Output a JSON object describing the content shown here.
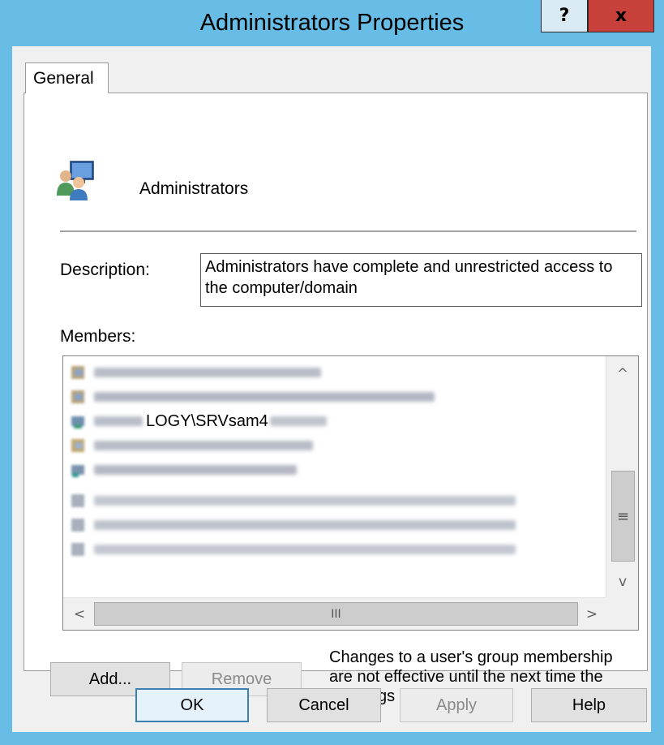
{
  "window": {
    "title": "Administrators Properties",
    "help_label": "?",
    "close_label": "x"
  },
  "tabs": [
    {
      "label": "General"
    }
  ],
  "group": {
    "name": "Administrators",
    "description_label": "Description:",
    "description": "Administrators have complete and unrestricted access to the computer/domain",
    "members_label": "Members:"
  },
  "members": [
    {
      "text": "",
      "blurred": true
    },
    {
      "text": "",
      "blurred": true
    },
    {
      "text": "LOGY\\SRVsam4",
      "blurred": false
    },
    {
      "text": "",
      "blurred": true
    },
    {
      "text": "",
      "blurred": true
    },
    {
      "text": "",
      "blurred": true
    },
    {
      "text": "",
      "blurred": true
    },
    {
      "text": "",
      "blurred": true
    }
  ],
  "scrollbars": {
    "up": "^",
    "down": "v",
    "left": "<",
    "right": ">",
    "v_grip": "≡",
    "h_grip": "III"
  },
  "member_buttons": {
    "add": "Add...",
    "remove": "Remove"
  },
  "note": "Changes to a user's group membership are not effective until the next time the user logs on.",
  "dialog_buttons": {
    "ok": "OK",
    "cancel": "Cancel",
    "apply": "Apply",
    "help": "Help"
  },
  "colors": {
    "window_frame": "#68bde6",
    "close_button": "#c7413a",
    "default_button_border": "#3c7fb1"
  }
}
